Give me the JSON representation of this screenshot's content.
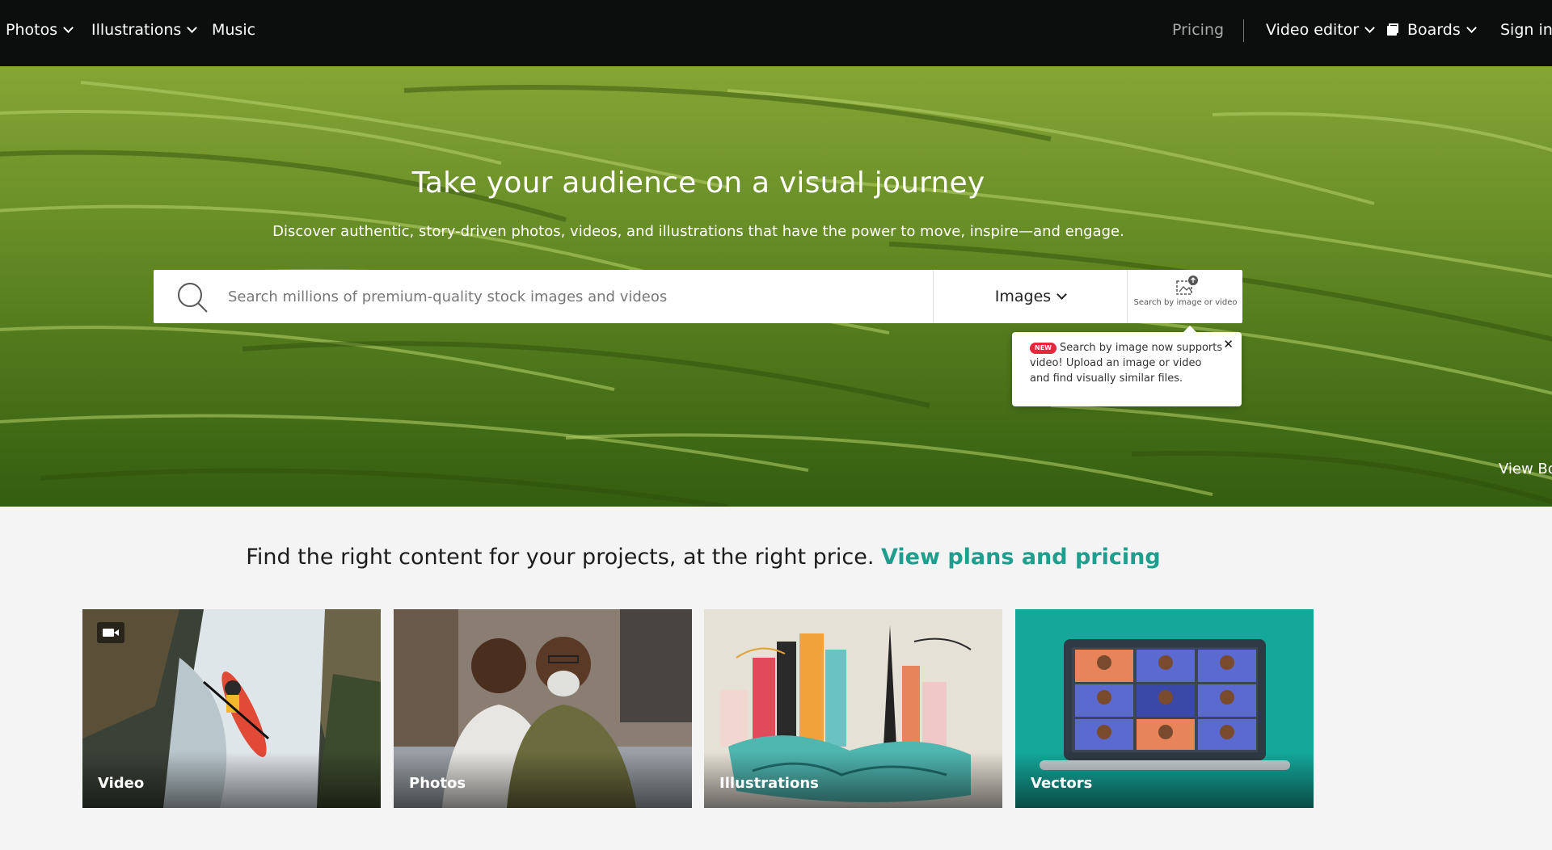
{
  "nav": {
    "left": [
      {
        "label": "Photos"
      },
      {
        "label": "Illustrations"
      },
      {
        "label": "Music"
      }
    ],
    "pricing": "Pricing",
    "video_editor": "Video editor",
    "boards": "Boards",
    "sign_in": "Sign in"
  },
  "hero": {
    "title": "Take your audience on a visual journey",
    "subtitle": "Discover authentic, story-driven photos, videos, and illustrations that have the power to move, inspire—and engage.",
    "view_board": "View Bo"
  },
  "search": {
    "placeholder": "Search millions of premium-quality stock images and videos",
    "type_selected": "Images",
    "image_search_label": "Search by image or video"
  },
  "tooltip": {
    "badge": "NEW",
    "text": "Search by image now supports video! Upload an image or video and find visually similar files.",
    "close": "✕"
  },
  "promo": {
    "text": "Find the right content for your projects, at the right price.",
    "link": "View plans and pricing"
  },
  "categories": [
    {
      "label": "Video"
    },
    {
      "label": "Photos"
    },
    {
      "label": "Illustrations"
    },
    {
      "label": "Vectors"
    }
  ],
  "colors": {
    "nav_bg": "#0c0d0d",
    "accent_link": "#1e9e8c",
    "badge_red": "#e7273c",
    "vectors_bg": "#14a89b"
  }
}
